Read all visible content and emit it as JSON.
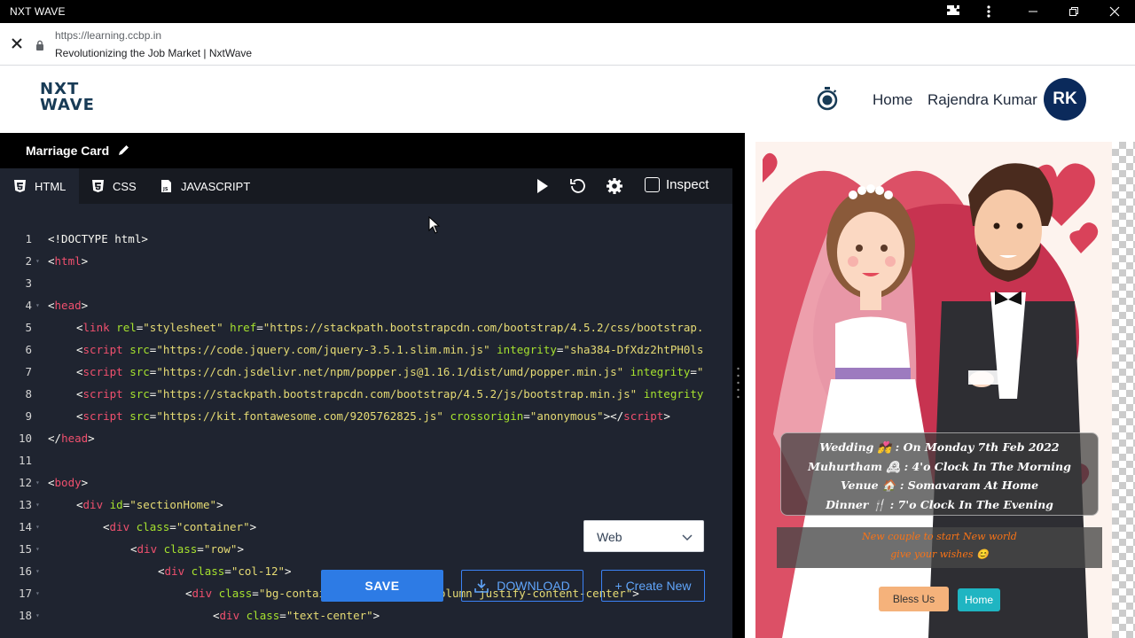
{
  "window": {
    "title": "NXT WAVE",
    "icons": [
      "extension-icon",
      "more-vert-icon",
      "minimize-icon",
      "restore-icon",
      "close-icon"
    ]
  },
  "browser": {
    "url": "https://learning.ccbp.in",
    "page_title": "Revolutionizing the Job Market | NxtWave"
  },
  "header": {
    "logo_line1": "NXT",
    "logo_line2": "WAVE",
    "home_label": "Home",
    "user_name": "Rajendra Kumar",
    "avatar_initials": "RK"
  },
  "editor": {
    "project_title": "Marriage Card",
    "tabs": [
      {
        "label": "HTML",
        "icon": "html5-icon",
        "active": true
      },
      {
        "label": "CSS",
        "icon": "css3-icon",
        "active": false
      },
      {
        "label": "JAVASCRIPT",
        "icon": "js-file-icon",
        "active": false
      }
    ],
    "inspect_label": "Inspect",
    "line_numbers": [
      "1",
      "2",
      "3",
      "4",
      "5",
      "6",
      "7",
      "8",
      "9",
      "10",
      "11",
      "12",
      "13",
      "14",
      "15",
      "16",
      "17",
      "18"
    ],
    "lines": [
      [
        {
          "t": "plain",
          "s": "<!DOCTYPE html>"
        }
      ],
      [
        {
          "t": "plain",
          "s": "<"
        },
        {
          "t": "tag",
          "s": "html"
        },
        {
          "t": "plain",
          "s": ">"
        }
      ],
      [],
      [
        {
          "t": "plain",
          "s": "<"
        },
        {
          "t": "tag",
          "s": "head"
        },
        {
          "t": "plain",
          "s": ">"
        }
      ],
      [
        {
          "t": "plain",
          "s": "<"
        },
        {
          "t": "tag",
          "s": "link"
        },
        {
          "t": "plain",
          "s": " "
        },
        {
          "t": "attr",
          "s": "rel"
        },
        {
          "t": "plain",
          "s": "="
        },
        {
          "t": "str",
          "s": "\"stylesheet\""
        },
        {
          "t": "plain",
          "s": " "
        },
        {
          "t": "attr",
          "s": "href"
        },
        {
          "t": "plain",
          "s": "="
        },
        {
          "t": "str",
          "s": "\"https://stackpath.bootstrapcdn.com/bootstrap/4.5.2/css/bootstrap."
        }
      ],
      [
        {
          "t": "plain",
          "s": "<"
        },
        {
          "t": "tag",
          "s": "script"
        },
        {
          "t": "plain",
          "s": " "
        },
        {
          "t": "attr",
          "s": "src"
        },
        {
          "t": "plain",
          "s": "="
        },
        {
          "t": "str",
          "s": "\"https://code.jquery.com/jquery-3.5.1.slim.min.js\""
        },
        {
          "t": "plain",
          "s": " "
        },
        {
          "t": "attr",
          "s": "integrity"
        },
        {
          "t": "plain",
          "s": "="
        },
        {
          "t": "str",
          "s": "\"sha384-DfXdz2htPH0ls"
        }
      ],
      [
        {
          "t": "plain",
          "s": "<"
        },
        {
          "t": "tag",
          "s": "script"
        },
        {
          "t": "plain",
          "s": " "
        },
        {
          "t": "attr",
          "s": "src"
        },
        {
          "t": "plain",
          "s": "="
        },
        {
          "t": "str",
          "s": "\"https://cdn.jsdelivr.net/npm/popper.js@1.16.1/dist/umd/popper.min.js\""
        },
        {
          "t": "plain",
          "s": " "
        },
        {
          "t": "attr",
          "s": "integrity"
        },
        {
          "t": "plain",
          "s": "="
        },
        {
          "t": "str",
          "s": "\""
        }
      ],
      [
        {
          "t": "plain",
          "s": "<"
        },
        {
          "t": "tag",
          "s": "script"
        },
        {
          "t": "plain",
          "s": " "
        },
        {
          "t": "attr",
          "s": "src"
        },
        {
          "t": "plain",
          "s": "="
        },
        {
          "t": "str",
          "s": "\"https://stackpath.bootstrapcdn.com/bootstrap/4.5.2/js/bootstrap.min.js\""
        },
        {
          "t": "plain",
          "s": " "
        },
        {
          "t": "attr",
          "s": "integrity"
        }
      ],
      [
        {
          "t": "plain",
          "s": "<"
        },
        {
          "t": "tag",
          "s": "script"
        },
        {
          "t": "plain",
          "s": " "
        },
        {
          "t": "attr",
          "s": "src"
        },
        {
          "t": "plain",
          "s": "="
        },
        {
          "t": "str",
          "s": "\"https://kit.fontawesome.com/9205762825.js\""
        },
        {
          "t": "plain",
          "s": " "
        },
        {
          "t": "attr",
          "s": "crossorigin"
        },
        {
          "t": "plain",
          "s": "="
        },
        {
          "t": "str",
          "s": "\"anonymous\""
        },
        {
          "t": "plain",
          "s": "></"
        },
        {
          "t": "tag",
          "s": "script"
        },
        {
          "t": "plain",
          "s": ">"
        }
      ],
      [
        {
          "t": "plain",
          "s": "</"
        },
        {
          "t": "tag",
          "s": "head"
        },
        {
          "t": "plain",
          "s": ">"
        }
      ],
      [],
      [
        {
          "t": "plain",
          "s": "<"
        },
        {
          "t": "tag",
          "s": "body"
        },
        {
          "t": "plain",
          "s": ">"
        }
      ],
      [
        {
          "t": "plain",
          "s": "<"
        },
        {
          "t": "tag",
          "s": "div"
        },
        {
          "t": "plain",
          "s": " "
        },
        {
          "t": "attr",
          "s": "id"
        },
        {
          "t": "plain",
          "s": "="
        },
        {
          "t": "str",
          "s": "\"sectionHome\""
        },
        {
          "t": "plain",
          "s": ">"
        }
      ],
      [
        {
          "t": "plain",
          "s": "<"
        },
        {
          "t": "tag",
          "s": "div"
        },
        {
          "t": "plain",
          "s": " "
        },
        {
          "t": "attr",
          "s": "class"
        },
        {
          "t": "plain",
          "s": "="
        },
        {
          "t": "str",
          "s": "\"container\""
        },
        {
          "t": "plain",
          "s": ">"
        }
      ],
      [
        {
          "t": "plain",
          "s": "<"
        },
        {
          "t": "tag",
          "s": "div"
        },
        {
          "t": "plain",
          "s": " "
        },
        {
          "t": "attr",
          "s": "class"
        },
        {
          "t": "plain",
          "s": "="
        },
        {
          "t": "str",
          "s": "\"row\""
        },
        {
          "t": "plain",
          "s": ">"
        }
      ],
      [
        {
          "t": "plain",
          "s": "<"
        },
        {
          "t": "tag",
          "s": "div"
        },
        {
          "t": "plain",
          "s": " "
        },
        {
          "t": "attr",
          "s": "class"
        },
        {
          "t": "plain",
          "s": "="
        },
        {
          "t": "str",
          "s": "\"col-12\""
        },
        {
          "t": "plain",
          "s": ">"
        }
      ],
      [
        {
          "t": "plain",
          "s": "<"
        },
        {
          "t": "tag",
          "s": "div"
        },
        {
          "t": "plain",
          "s": " "
        },
        {
          "t": "attr",
          "s": "class"
        },
        {
          "t": "plain",
          "s": "="
        },
        {
          "t": "str",
          "s": "\"bg-container d-flex flex-column justify-content-center\""
        },
        {
          "t": "plain",
          "s": ">"
        }
      ],
      [
        {
          "t": "plain",
          "s": "<"
        },
        {
          "t": "tag",
          "s": "div"
        },
        {
          "t": "plain",
          "s": " "
        },
        {
          "t": "attr",
          "s": "class"
        },
        {
          "t": "plain",
          "s": "="
        },
        {
          "t": "str",
          "s": "\"text-center\""
        },
        {
          "t": "plain",
          "s": ">"
        }
      ]
    ],
    "view_select": "Web",
    "save_label": "SAVE",
    "download_label": "DOWNLOAD",
    "create_label": "+ Create New"
  },
  "preview": {
    "info_lines": [
      "Wedding 💏 : On Monday 7th Feb 2022",
      "Muhurtham 🕰 : 4'o Clock In The Morning",
      "Venue 🏠 : Somavaram At Home",
      "Dinner 🍴 : 7'o Clock In The Evening"
    ],
    "wish_line1": "New couple to start New world",
    "wish_line2": "give your wishes 😊",
    "bless_label": "Bless Us",
    "home_label": "Home"
  },
  "colors": {
    "brand_navy": "#183b56",
    "editor_bg": "#1f2430",
    "save_blue": "#2d7be5",
    "tag_red": "#f0506e",
    "attr_green": "#a6e22e",
    "string_yellow": "#e6db74"
  }
}
